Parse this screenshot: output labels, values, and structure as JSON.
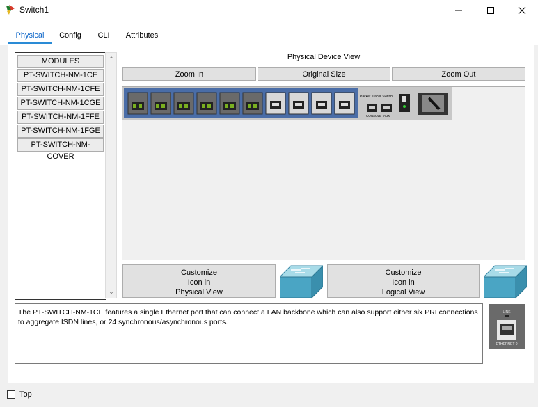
{
  "window": {
    "title": "Switch1"
  },
  "tabs": [
    {
      "label": "Physical",
      "active": true
    },
    {
      "label": "Config",
      "active": false
    },
    {
      "label": "CLI",
      "active": false
    },
    {
      "label": "Attributes",
      "active": false
    }
  ],
  "modules": {
    "header": "MODULES",
    "items": [
      "PT-SWITCH-NM-1CE",
      "PT-SWITCH-NM-1CFE",
      "PT-SWITCH-NM-1CGE",
      "PT-SWITCH-NM-1FFE",
      "PT-SWITCH-NM-1FGE",
      "PT-SWITCH-NM-COVER"
    ]
  },
  "device_view": {
    "title": "Physical Device View",
    "zoom_in": "Zoom In",
    "original_size": "Original Size",
    "zoom_out": "Zoom Out",
    "device_label": "Packet Tracer Switch",
    "console_label": "CONSOLE",
    "aux_label": "AUX"
  },
  "customize": {
    "physical": {
      "line1": "Customize",
      "line2": "Icon in",
      "line3": "Physical View"
    },
    "logical": {
      "line1": "Customize",
      "line2": "Icon in",
      "line3": "Logical View"
    }
  },
  "description": "The PT-SWITCH-NM-1CE features a single Ethernet port that can connect a LAN backbone which can also support either six PRI connections to aggregate ISDN lines, or 24 synchronous/asynchronous ports.",
  "module_image": {
    "link_label": "LINK",
    "port_label": "ETHERNET 0"
  },
  "footer": {
    "top_label": "Top",
    "top_checked": false
  },
  "colors": {
    "accent": "#0a64c8",
    "switch_body": "#4a6da7",
    "switch_icon": "#4aa5c4"
  }
}
